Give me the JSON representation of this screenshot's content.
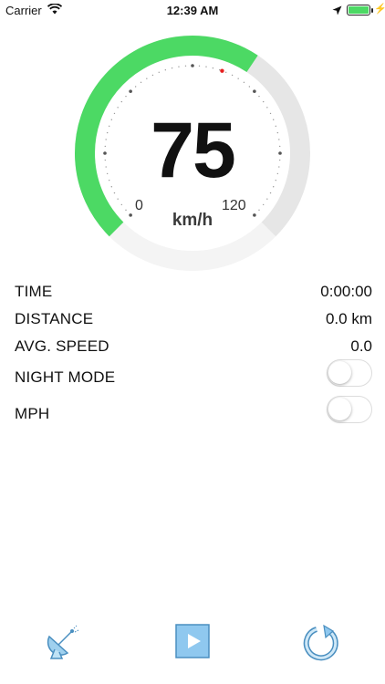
{
  "status_bar": {
    "carrier": "Carrier",
    "time": "12:39 AM"
  },
  "gauge": {
    "speed": "75",
    "unit": "km/h",
    "min_label": "0",
    "max_label": "120",
    "fill_fraction": 0.625,
    "colors": {
      "active": "#4cd964",
      "inactive": "#e6e6e6",
      "needle_dot": "#e62020"
    }
  },
  "stats": [
    {
      "label": "TIME",
      "value": "0:00:00"
    },
    {
      "label": "DISTANCE",
      "value": "0.0 km"
    },
    {
      "label": "AVG. SPEED",
      "value": "0.0"
    }
  ],
  "toggles": [
    {
      "label": "NIGHT MODE",
      "on": false
    },
    {
      "label": "MPH",
      "on": false
    }
  ],
  "toolbar": [
    {
      "icon": "satellite-dish-icon"
    },
    {
      "icon": "play-icon"
    },
    {
      "icon": "reset-icon"
    }
  ]
}
